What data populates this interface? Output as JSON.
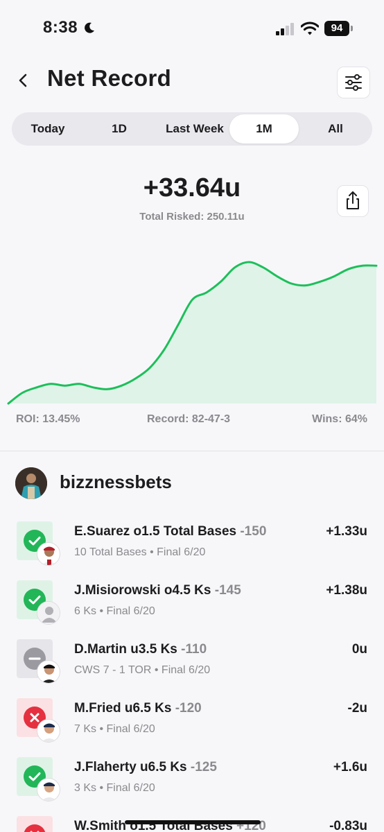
{
  "status_bar": {
    "time": "8:38",
    "battery": "94"
  },
  "header": {
    "title": "Net Record"
  },
  "tabs": [
    {
      "label": "Today",
      "active": false
    },
    {
      "label": "1D",
      "active": false
    },
    {
      "label": "Last Week",
      "active": false
    },
    {
      "label": "1M",
      "active": true
    },
    {
      "label": "All",
      "active": false
    }
  ],
  "summary": {
    "net": "+33.64u",
    "total_risked": "Total Risked: 250.11u"
  },
  "chart_data": {
    "type": "area",
    "color": "#1dbf5a",
    "fill": "#dff3e8",
    "values": [
      0,
      3,
      4.5,
      5.5,
      5,
      5.5,
      4.5,
      4,
      5,
      7,
      10,
      15,
      22,
      29,
      31,
      34,
      38,
      39.5,
      38,
      35.5,
      33.5,
      33,
      34,
      35.5,
      37.5,
      38.5,
      38.5
    ]
  },
  "stats": {
    "roi": "ROI: 13.45%",
    "record": "Record: 82-47-3",
    "wins": "Wins: 64%"
  },
  "profile": {
    "username": "bizznessbets"
  },
  "bets": [
    {
      "status": "win",
      "title": "E.Suarez o1.5 Total Bases",
      "odds": "-150",
      "sub": "10 Total Bases • Final 6/20",
      "result": "+1.33u",
      "thumb": "jersey-red"
    },
    {
      "status": "win",
      "title": "J.Misiorowski o4.5 Ks",
      "odds": "-145",
      "sub": "6 Ks • Final 6/20",
      "result": "+1.38u",
      "thumb": "placeholder"
    },
    {
      "status": "push",
      "title": "D.Martin u3.5 Ks",
      "odds": "-110",
      "sub": "CWS 7 - 1 TOR • Final 6/20",
      "result": "0u",
      "thumb": "jersey-black"
    },
    {
      "status": "loss",
      "title": "M.Fried u6.5 Ks",
      "odds": "-120",
      "sub": "7 Ks • Final 6/20",
      "result": "-2u",
      "thumb": "jersey-navy"
    },
    {
      "status": "win",
      "title": "J.Flaherty u6.5 Ks",
      "odds": "-125",
      "sub": "3 Ks • Final 6/20",
      "result": "+1.6u",
      "thumb": "jersey-navy"
    },
    {
      "status": "loss",
      "title": "W.Smith o1.5 Total Bases",
      "odds": "+120",
      "sub": "",
      "result": "-0.83u",
      "thumb": "none"
    }
  ]
}
